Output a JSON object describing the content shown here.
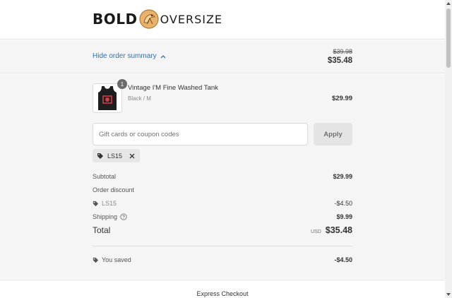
{
  "brand": {
    "word1": "BOLD",
    "word2": "OVERSIZE"
  },
  "summary": {
    "toggle_label": "Hide order summary",
    "compare_at_total": "$39.98",
    "total": "$35.48"
  },
  "product": {
    "name": "Vintage I'M Fine Washed Tank",
    "variant": "Black / M",
    "quantity": "1",
    "price": "$29.99"
  },
  "coupon": {
    "placeholder": "Gift cards or coupon codes",
    "apply_label": "Apply",
    "applied_code": "LS15"
  },
  "totals": {
    "subtotal_label": "Subtotal",
    "subtotal_value": "$29.99",
    "order_discount_label": "Order discount",
    "discount_code": "LS15",
    "discount_value": "-$4.50",
    "shipping_label": "Shipping",
    "shipping_value": "$9.99",
    "total_label": "Total",
    "currency": "USD",
    "total_value": "$35.48",
    "saved_label": "You saved",
    "saved_value": "-$4.50"
  },
  "footer": {
    "express_label": "Express Checkout"
  },
  "colors": {
    "link": "#2f6fb8",
    "panel": "#f5f5f5",
    "badge": "#6b6b6b"
  }
}
